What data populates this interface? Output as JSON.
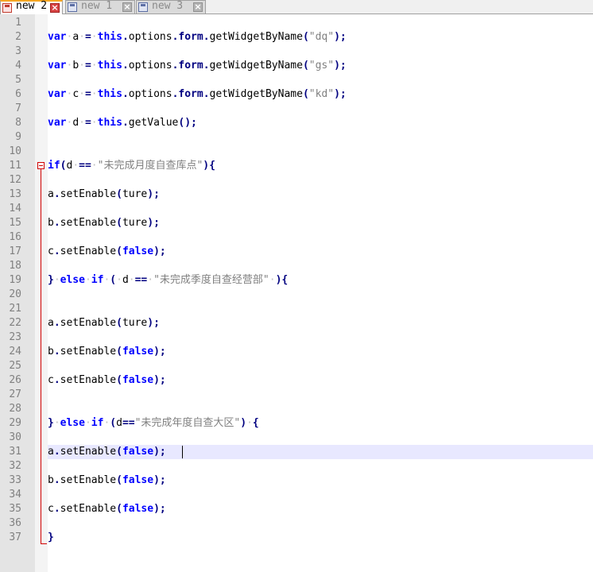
{
  "tabs": [
    {
      "label": "new 2",
      "active": true
    },
    {
      "label": "new 1",
      "active": false
    },
    {
      "label": "new 3",
      "active": false
    }
  ],
  "lines": [
    {
      "n": "1",
      "tokens": []
    },
    {
      "n": "2",
      "tokens": [
        [
          "kw",
          "var"
        ],
        [
          "sp",
          "·"
        ],
        [
          "plain",
          "a"
        ],
        [
          "sp",
          "·"
        ],
        [
          "op",
          "="
        ],
        [
          "sp",
          "·"
        ],
        [
          "kw",
          "this"
        ],
        [
          "op",
          "."
        ],
        [
          "plain",
          "options"
        ],
        [
          "op",
          "."
        ],
        [
          "obj",
          "form"
        ],
        [
          "op",
          "."
        ],
        [
          "plain",
          "getWidgetByName"
        ],
        [
          "op",
          "("
        ],
        [
          "str",
          "\"dq\""
        ],
        [
          "op",
          ");"
        ]
      ]
    },
    {
      "n": "3",
      "tokens": []
    },
    {
      "n": "4",
      "tokens": [
        [
          "kw",
          "var"
        ],
        [
          "sp",
          "·"
        ],
        [
          "plain",
          "b"
        ],
        [
          "sp",
          "·"
        ],
        [
          "op",
          "="
        ],
        [
          "sp",
          "·"
        ],
        [
          "kw",
          "this"
        ],
        [
          "op",
          "."
        ],
        [
          "plain",
          "options"
        ],
        [
          "op",
          "."
        ],
        [
          "obj",
          "form"
        ],
        [
          "op",
          "."
        ],
        [
          "plain",
          "getWidgetByName"
        ],
        [
          "op",
          "("
        ],
        [
          "str",
          "\"gs\""
        ],
        [
          "op",
          ");"
        ]
      ]
    },
    {
      "n": "5",
      "tokens": []
    },
    {
      "n": "6",
      "tokens": [
        [
          "kw",
          "var"
        ],
        [
          "sp",
          "·"
        ],
        [
          "plain",
          "c"
        ],
        [
          "sp",
          "·"
        ],
        [
          "op",
          "="
        ],
        [
          "sp",
          "·"
        ],
        [
          "kw",
          "this"
        ],
        [
          "op",
          "."
        ],
        [
          "plain",
          "options"
        ],
        [
          "op",
          "."
        ],
        [
          "obj",
          "form"
        ],
        [
          "op",
          "."
        ],
        [
          "plain",
          "getWidgetByName"
        ],
        [
          "op",
          "("
        ],
        [
          "str",
          "\"kd\""
        ],
        [
          "op",
          ");"
        ]
      ]
    },
    {
      "n": "7",
      "tokens": []
    },
    {
      "n": "8",
      "tokens": [
        [
          "kw",
          "var"
        ],
        [
          "sp",
          "·"
        ],
        [
          "plain",
          "d"
        ],
        [
          "sp",
          "·"
        ],
        [
          "op",
          "="
        ],
        [
          "sp",
          "·"
        ],
        [
          "kw",
          "this"
        ],
        [
          "op",
          "."
        ],
        [
          "plain",
          "getValue"
        ],
        [
          "op",
          "();"
        ]
      ]
    },
    {
      "n": "9",
      "tokens": []
    },
    {
      "n": "10",
      "tokens": []
    },
    {
      "n": "11",
      "tokens": [
        [
          "kw",
          "if"
        ],
        [
          "op",
          "("
        ],
        [
          "plain",
          "d"
        ],
        [
          "sp",
          "·"
        ],
        [
          "op",
          "=="
        ],
        [
          "sp",
          "·"
        ],
        [
          "str",
          "\"未完成月度自查库点\""
        ],
        [
          "op",
          ")"
        ],
        [
          "op",
          "{"
        ]
      ]
    },
    {
      "n": "12",
      "tokens": []
    },
    {
      "n": "13",
      "tokens": [
        [
          "plain",
          "a"
        ],
        [
          "op",
          "."
        ],
        [
          "plain",
          "setEnable"
        ],
        [
          "op",
          "("
        ],
        [
          "plain",
          "ture"
        ],
        [
          "op",
          ");"
        ]
      ]
    },
    {
      "n": "14",
      "tokens": []
    },
    {
      "n": "15",
      "tokens": [
        [
          "plain",
          "b"
        ],
        [
          "op",
          "."
        ],
        [
          "plain",
          "setEnable"
        ],
        [
          "op",
          "("
        ],
        [
          "plain",
          "ture"
        ],
        [
          "op",
          ");"
        ]
      ]
    },
    {
      "n": "16",
      "tokens": []
    },
    {
      "n": "17",
      "tokens": [
        [
          "plain",
          "c"
        ],
        [
          "op",
          "."
        ],
        [
          "plain",
          "setEnable"
        ],
        [
          "op",
          "("
        ],
        [
          "kw",
          "false"
        ],
        [
          "op",
          ");"
        ]
      ]
    },
    {
      "n": "18",
      "tokens": []
    },
    {
      "n": "19",
      "tokens": [
        [
          "op",
          "}"
        ],
        [
          "sp",
          "·"
        ],
        [
          "kw",
          "else"
        ],
        [
          "sp",
          "·"
        ],
        [
          "kw",
          "if"
        ],
        [
          "sp",
          "·"
        ],
        [
          "op",
          "("
        ],
        [
          "sp",
          "·"
        ],
        [
          "plain",
          "d"
        ],
        [
          "sp",
          "·"
        ],
        [
          "op",
          "=="
        ],
        [
          "sp",
          "·"
        ],
        [
          "str",
          "\"未完成季度自查经营部\""
        ],
        [
          "sp",
          "·"
        ],
        [
          "op",
          ")"
        ],
        [
          "op",
          "{"
        ]
      ]
    },
    {
      "n": "20",
      "tokens": []
    },
    {
      "n": "21",
      "tokens": []
    },
    {
      "n": "22",
      "tokens": [
        [
          "plain",
          "a"
        ],
        [
          "op",
          "."
        ],
        [
          "plain",
          "setEnable"
        ],
        [
          "op",
          "("
        ],
        [
          "plain",
          "ture"
        ],
        [
          "op",
          ");"
        ]
      ]
    },
    {
      "n": "23",
      "tokens": []
    },
    {
      "n": "24",
      "tokens": [
        [
          "plain",
          "b"
        ],
        [
          "op",
          "."
        ],
        [
          "plain",
          "setEnable"
        ],
        [
          "op",
          "("
        ],
        [
          "kw",
          "false"
        ],
        [
          "op",
          ");"
        ]
      ]
    },
    {
      "n": "25",
      "tokens": []
    },
    {
      "n": "26",
      "tokens": [
        [
          "plain",
          "c"
        ],
        [
          "op",
          "."
        ],
        [
          "plain",
          "setEnable"
        ],
        [
          "op",
          "("
        ],
        [
          "kw",
          "false"
        ],
        [
          "op",
          ");"
        ]
      ]
    },
    {
      "n": "27",
      "tokens": []
    },
    {
      "n": "28",
      "tokens": []
    },
    {
      "n": "29",
      "tokens": [
        [
          "op",
          "}"
        ],
        [
          "sp",
          "·"
        ],
        [
          "kw",
          "else"
        ],
        [
          "sp",
          "·"
        ],
        [
          "kw",
          "if"
        ],
        [
          "sp",
          "·"
        ],
        [
          "op",
          "("
        ],
        [
          "plain",
          "d"
        ],
        [
          "op",
          "=="
        ],
        [
          "str",
          "\"未完成年度自查大区\""
        ],
        [
          "op",
          ")"
        ],
        [
          "sp",
          "·"
        ],
        [
          "op",
          "{"
        ]
      ]
    },
    {
      "n": "30",
      "tokens": []
    },
    {
      "n": "31",
      "tokens": [
        [
          "plain",
          "a"
        ],
        [
          "op",
          "."
        ],
        [
          "plain",
          "setEnable"
        ],
        [
          "op",
          "("
        ],
        [
          "kw",
          "false"
        ],
        [
          "op",
          ");"
        ]
      ]
    },
    {
      "n": "32",
      "tokens": []
    },
    {
      "n": "33",
      "tokens": [
        [
          "plain",
          "b"
        ],
        [
          "op",
          "."
        ],
        [
          "plain",
          "setEnable"
        ],
        [
          "op",
          "("
        ],
        [
          "kw",
          "false"
        ],
        [
          "op",
          ");"
        ]
      ]
    },
    {
      "n": "34",
      "tokens": []
    },
    {
      "n": "35",
      "tokens": [
        [
          "plain",
          "c"
        ],
        [
          "op",
          "."
        ],
        [
          "plain",
          "setEnable"
        ],
        [
          "op",
          "("
        ],
        [
          "kw",
          "false"
        ],
        [
          "op",
          ");"
        ]
      ]
    },
    {
      "n": "36",
      "tokens": []
    },
    {
      "n": "37",
      "tokens": [
        [
          "op",
          "}"
        ]
      ]
    }
  ]
}
